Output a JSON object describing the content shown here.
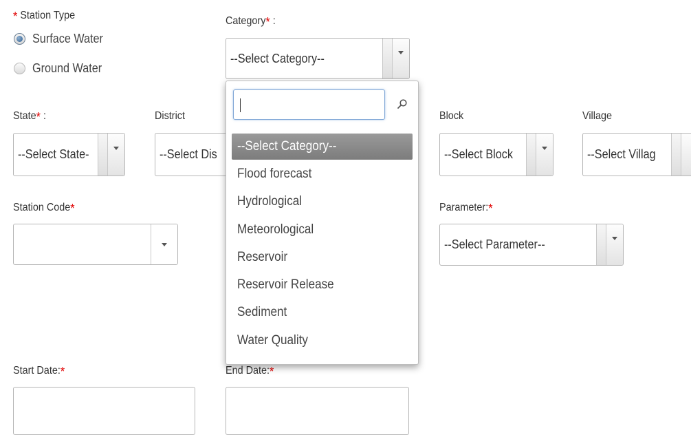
{
  "station_type": {
    "label": "Station Type",
    "required_mark": "*",
    "options": [
      {
        "label": "Surface Water",
        "checked": true
      },
      {
        "label": "Ground Water",
        "checked": false
      }
    ]
  },
  "category": {
    "label": "Category",
    "required_mark": "*",
    "colon": ":",
    "selected": "--Select Category--"
  },
  "state": {
    "label": "State",
    "required_mark": "*",
    "colon": ":",
    "selected": "--Select State-"
  },
  "district": {
    "label": "District",
    "selected": "--Select Dis"
  },
  "block": {
    "label": "Block",
    "selected": "--Select Block"
  },
  "village": {
    "label": "Village",
    "selected": "--Select Villag"
  },
  "station_code": {
    "label": "Station Code",
    "required_mark": "*",
    "selected": ""
  },
  "parameter": {
    "label": "Parameter:",
    "required_mark": "*",
    "selected": "--Select Parameter--"
  },
  "start_date": {
    "label": "Start Date:",
    "required_mark": "*",
    "value": ""
  },
  "end_date": {
    "label": "End Date:",
    "required_mark": "*",
    "value": ""
  },
  "category_dropdown": {
    "search_value": "",
    "search_icon": "search-icon",
    "items": [
      "--Select Category--",
      "Flood forecast",
      "Hydrological",
      "Meteorological",
      "Reservoir",
      "Reservoir Release",
      "Sediment",
      "Water Quality"
    ],
    "selected_index": 0
  },
  "colors": {
    "required": "#e00000",
    "selected_item_bg": "#8a8a8a",
    "focus_border": "#7fa6d6"
  }
}
